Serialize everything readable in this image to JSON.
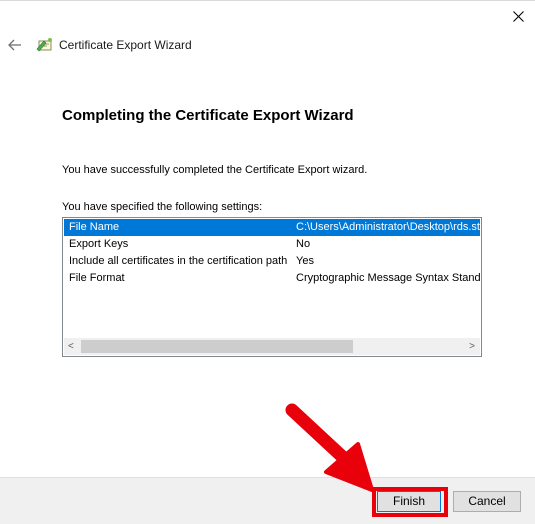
{
  "window": {
    "title": "Certificate Export Wizard",
    "close_icon": "close-icon",
    "back_icon": "back-arrow-icon",
    "app_icon": "certificate-wizard-icon"
  },
  "page": {
    "heading": "Completing the Certificate Export Wizard",
    "success_text": "You have successfully completed the Certificate Export wizard.",
    "settings_label": "You have specified the following settings:"
  },
  "settings": [
    {
      "name": "File Name",
      "value": "C:\\Users\\Administrator\\Desktop\\rds.st",
      "selected": true
    },
    {
      "name": "Export Keys",
      "value": "No",
      "selected": false
    },
    {
      "name": "Include all certificates in the certification path",
      "value": "Yes",
      "selected": false
    },
    {
      "name": "File Format",
      "value": "Cryptographic Message Syntax Standa",
      "selected": false
    }
  ],
  "scrollbar": {
    "left_arrow": "<",
    "right_arrow": ">"
  },
  "buttons": {
    "finish": "Finish",
    "cancel": "Cancel"
  },
  "annotation": {
    "arrow_color": "#e8000b",
    "highlight_color": "#e8000b",
    "selection_color": "#0078d7"
  }
}
